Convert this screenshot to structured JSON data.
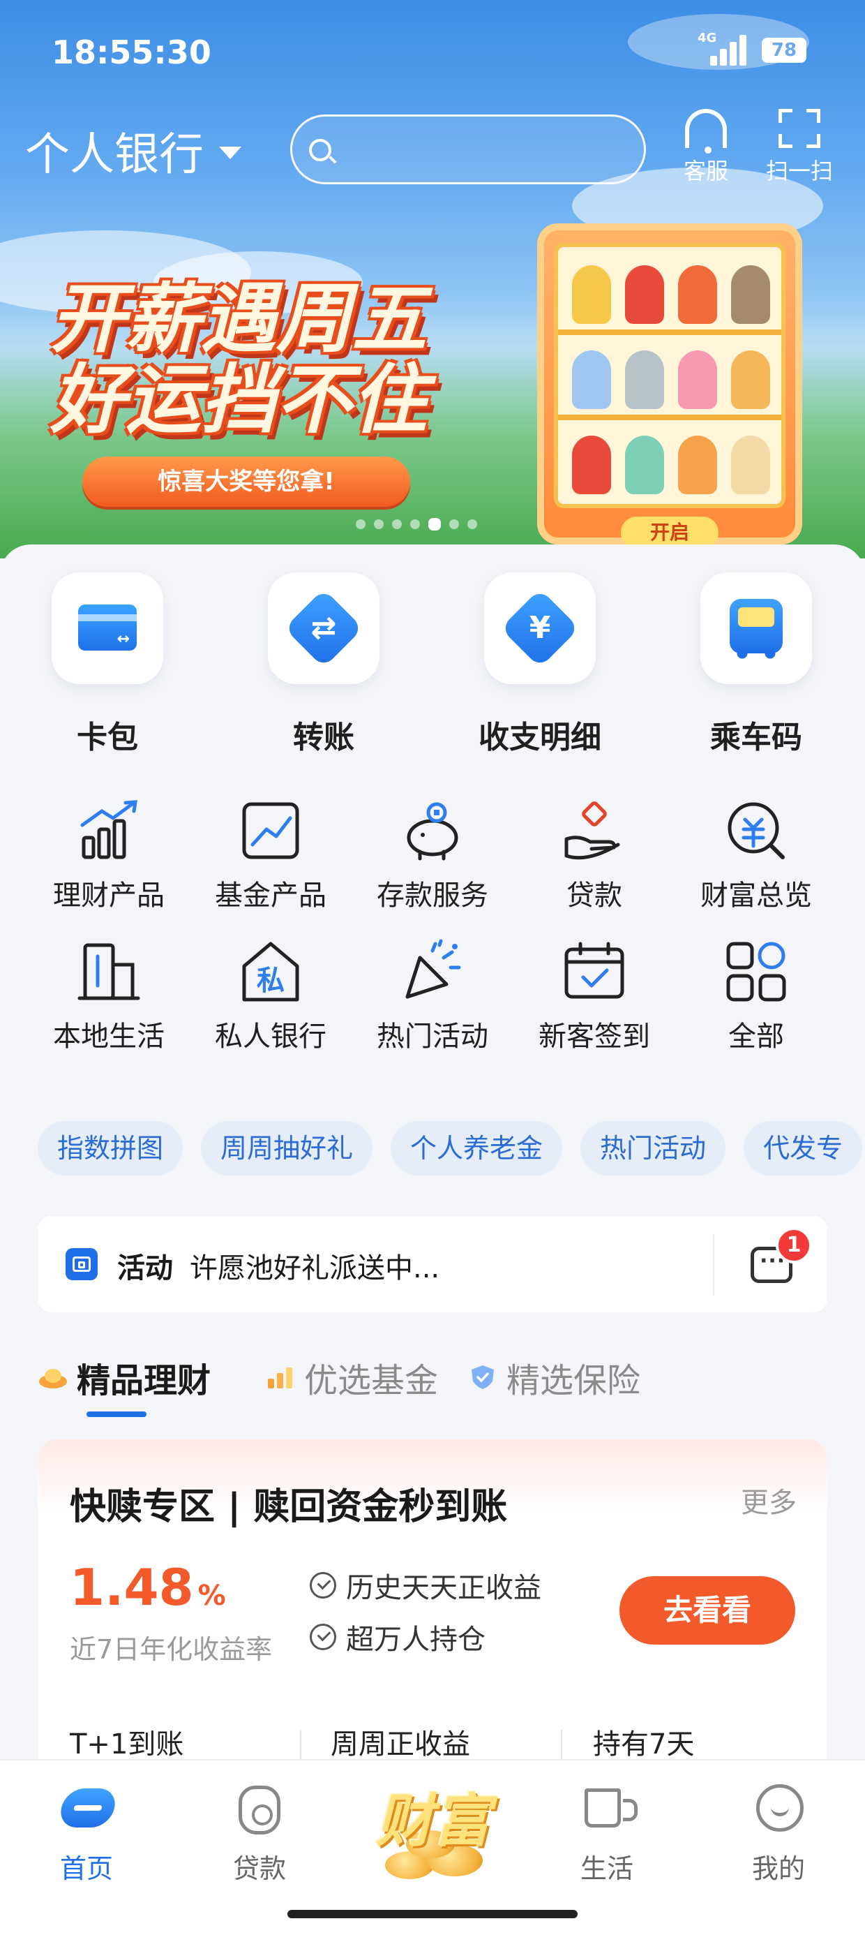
{
  "status_bar": {
    "time": "18:55:30",
    "network": "4G",
    "battery": "78"
  },
  "header": {
    "bank_switch_label": "个人银行",
    "search_placeholder": "",
    "customer_service_label": "客服",
    "scan_label": "扫一扫"
  },
  "banner": {
    "title_line1": "开薪遇周五",
    "title_line2": "好运挡不住",
    "pill": "惊喜大奖等您拿!",
    "open_label": "开启",
    "dots_total": 7,
    "dots_active_index": 4
  },
  "quick_actions": [
    {
      "label": "卡包",
      "icon": "card-wallet-icon"
    },
    {
      "label": "转账",
      "icon": "transfer-icon"
    },
    {
      "label": "收支明细",
      "icon": "yuan-icon"
    },
    {
      "label": "乘车码",
      "icon": "bus-icon"
    }
  ],
  "services": [
    {
      "label": "理财产品",
      "icon": "growth-chart-icon"
    },
    {
      "label": "基金产品",
      "icon": "trend-icon"
    },
    {
      "label": "存款服务",
      "icon": "piggy-bank-icon"
    },
    {
      "label": "贷款",
      "icon": "hand-coin-icon"
    },
    {
      "label": "财富总览",
      "icon": "wealth-search-icon"
    },
    {
      "label": "本地生活",
      "icon": "building-icon"
    },
    {
      "label": "私人银行",
      "icon": "private-house-icon"
    },
    {
      "label": "热门活动",
      "icon": "party-popper-icon"
    },
    {
      "label": "新客签到",
      "icon": "calendar-check-icon"
    },
    {
      "label": "全部",
      "icon": "grid-all-icon"
    }
  ],
  "tags": [
    "指数拼图",
    "周周抽好礼",
    "个人养老金",
    "热门活动",
    "代发专"
  ],
  "activity": {
    "tag": "活动",
    "text": "许愿池好礼派送中...",
    "message_badge": "1"
  },
  "product_tabs": [
    {
      "label": "精品理财",
      "active": true
    },
    {
      "label": "优选基金",
      "active": false
    },
    {
      "label": "精选保险",
      "active": false
    }
  ],
  "product_card": {
    "title": "快赎专区 | 赎回资金秒到账",
    "more": "更多",
    "rate": "1.48",
    "rate_unit": "%",
    "rate_label": "近7日年化收益率",
    "features": [
      "历史天天正收益",
      "超万人持仓"
    ],
    "button": "去看看",
    "footer": [
      "T+1到账",
      "周周正收益",
      "持有7天"
    ]
  },
  "bottom_nav": [
    {
      "label": "首页",
      "active": true
    },
    {
      "label": "贷款",
      "active": false
    },
    {
      "label": "财富",
      "active": false
    },
    {
      "label": "生活",
      "active": false
    },
    {
      "label": "我的",
      "active": false
    }
  ],
  "colors": {
    "accent": "#1f6fe8",
    "orange": "#f35a2b",
    "tag_bg": "#e5edf8",
    "tag_text": "#2d6bd4"
  }
}
